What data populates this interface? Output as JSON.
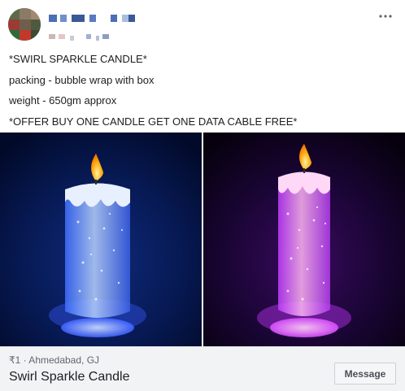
{
  "post": {
    "lines": [
      "*SWIRL SPARKLE CANDLE*",
      "packing - bubble wrap with box",
      "weight - 650gm approx",
      "*OFFER BUY ONE CANDLE GET ONE DATA CABLE FREE*"
    ],
    "more_icon": "more-horizontal-icon"
  },
  "listing": {
    "price_location": "₹1 · Ahmedabad, GJ",
    "title": "Swirl Sparkle Candle",
    "message_label": "Message"
  },
  "colors": {
    "left_glow": "#3a6cff",
    "right_glow": "#d84cff",
    "flame": "#ffb019"
  }
}
